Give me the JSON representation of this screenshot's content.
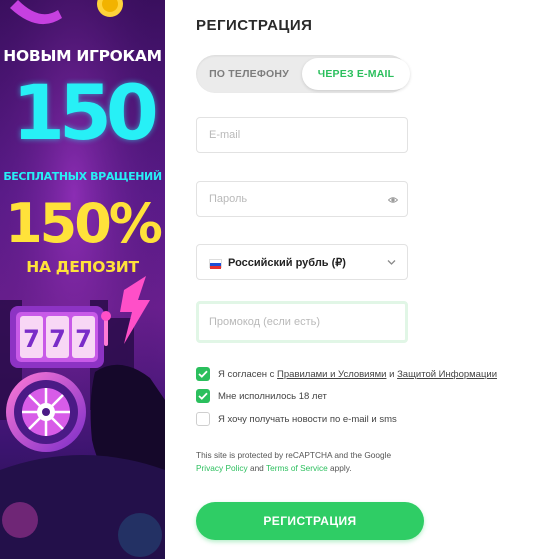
{
  "promo": {
    "line1": "НОВЫМ ИГРОКАМ",
    "number1": "150",
    "line2": "БЕСПЛАТНЫХ ВРАЩЕНИЙ",
    "number2": "150%",
    "line3": "НА ДЕПОЗИТ"
  },
  "form": {
    "title": "РЕГИСТРАЦИЯ",
    "tabs": [
      {
        "label": "ПО ТЕЛЕФОНУ",
        "active": false
      },
      {
        "label": "ЧЕРЕЗ E-MAIL",
        "active": true
      }
    ],
    "email": {
      "placeholder": "E-mail",
      "value": ""
    },
    "password": {
      "placeholder": "Пароль",
      "value": "",
      "icon": "eye-icon"
    },
    "currency": {
      "value": "Российский рубль (₽)",
      "flag": "russia-flag-icon",
      "icon": "chevron-down-icon"
    },
    "promo_code": {
      "placeholder": "Промокод (если есть)",
      "value": ""
    },
    "checkboxes": [
      {
        "checked": true,
        "text_before": "Я согласен с",
        "link1": "Правилами и Условиями",
        "and": "и",
        "link2": "Защитой Информации"
      },
      {
        "checked": true,
        "text": "Мне исполнилось 18 лет"
      },
      {
        "checked": false,
        "text": "Я хочу получать новости по e-mail и sms"
      }
    ],
    "recaptcha": {
      "text1": "This site is protected by reCAPTCHA and the Google",
      "privacy_link": "Privacy Policy",
      "and": "and",
      "terms_link": "Terms of Service",
      "apply": "apply."
    },
    "submit_label": "РЕГИСТРАЦИЯ"
  },
  "colors": {
    "accent": "#2bbf5d",
    "button": "#2fcd65",
    "promo_cyan": "#27f0f6",
    "promo_yellow": "#ffe23a",
    "promo_bg": "#5a1b8a"
  }
}
